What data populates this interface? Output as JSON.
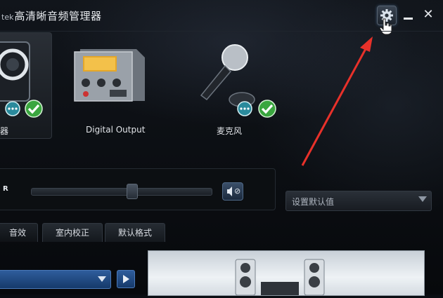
{
  "app": {
    "title_tail": "tek",
    "title": "高清晰音频管理器"
  },
  "window_controls": {
    "settings": "gear-icon",
    "minimize": "minimize-icon",
    "close_glyph": "✕"
  },
  "devices": [
    {
      "label": "器",
      "icon": "speaker-icon",
      "status": [
        "chat-badge",
        "check-badge"
      ],
      "selected": true
    },
    {
      "label": "Digital Output",
      "icon": "digital-output-icon",
      "status": []
    },
    {
      "label": "麦克风",
      "icon": "microphone-icon",
      "status": [
        "chat-badge",
        "check-badge"
      ]
    }
  ],
  "volume": {
    "channel_label": "R",
    "balance_fraction": 0.54,
    "mute_label": "⊘"
  },
  "default_button": {
    "value": "设置默认值"
  },
  "tabs": [
    {
      "label": "音效"
    },
    {
      "label": "室内校正"
    },
    {
      "label": "默认格式"
    }
  ],
  "colors": {
    "accent_blue": "#2f5d9c",
    "check_green": "#3aa63f",
    "annotation_red": "#e8312a"
  }
}
